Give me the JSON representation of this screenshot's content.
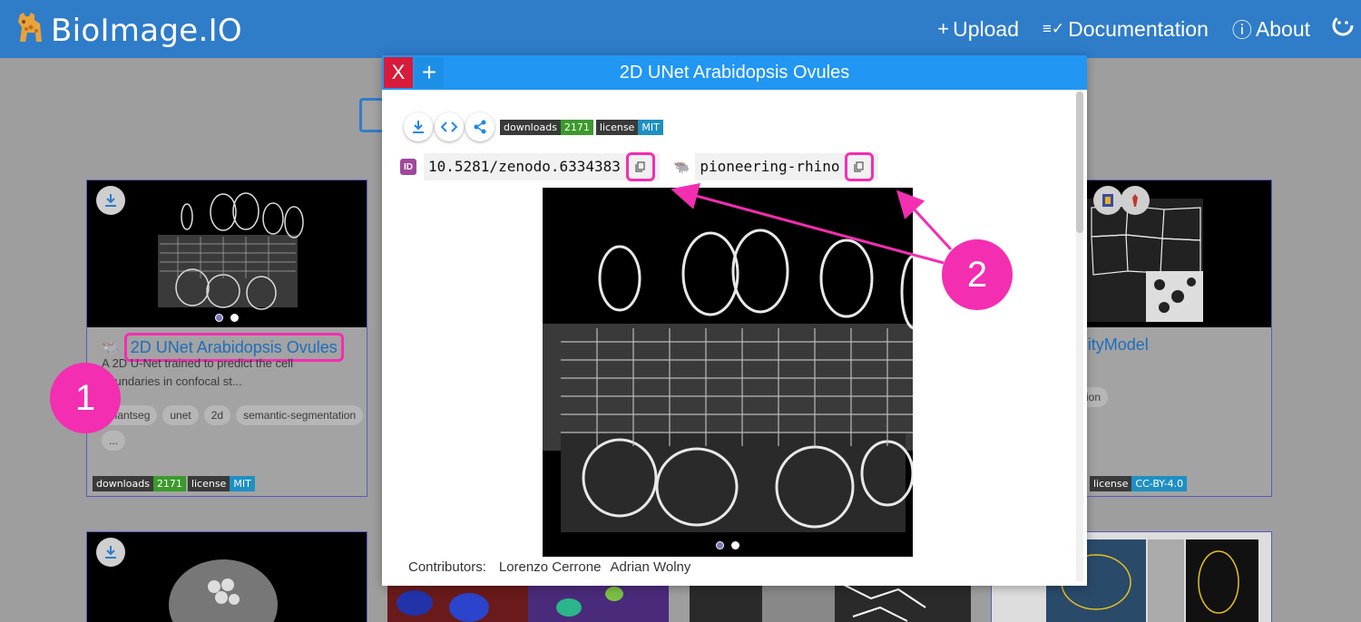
{
  "header": {
    "brand": "BioImage.IO",
    "nav": [
      {
        "icon": "+",
        "label": "Upload"
      },
      {
        "icon": "≡✓",
        "label": "Documentation"
      },
      {
        "icon": "ⓘ",
        "label": "About"
      }
    ]
  },
  "cards": [
    {
      "title": "2D UNet Arabidopsis Ovules",
      "description": "A 2D U-Net trained to predict the cell boundaries in confocal st...",
      "tags": [
        "plantseg",
        "unet",
        "2d",
        "semantic-segmentation",
        "..."
      ],
      "downloads_label": "downloads",
      "downloads": "2171",
      "license_label": "license",
      "license": "MIT"
    },
    {
      "title_fragment": "aAffinityModel",
      "tag_fragment": "ntation",
      "license_label": "license",
      "license": "CC-BY-4.0"
    }
  ],
  "modal": {
    "title": "2D UNet Arabidopsis Ovules",
    "close_label": "X",
    "add_label": "+",
    "downloads_label": "downloads",
    "downloads": "2171",
    "license_label": "license",
    "license": "MIT",
    "id_badge": "ID",
    "doi": "10.5281/zenodo.6334383",
    "nickname_icon": "🐃",
    "nickname": "pioneering-rhino",
    "contributors_label": "Contributors:",
    "contributors": [
      "Lorenzo Cerrone",
      "Adrian Wolny"
    ]
  },
  "annotations": {
    "callout_1": "1",
    "callout_2": "2"
  },
  "colors": {
    "header": "#2f7cc9",
    "modal_header": "#2196f3",
    "annotation": "#f32eb1",
    "close": "#d81b3a",
    "link": "#1f6dbb"
  }
}
